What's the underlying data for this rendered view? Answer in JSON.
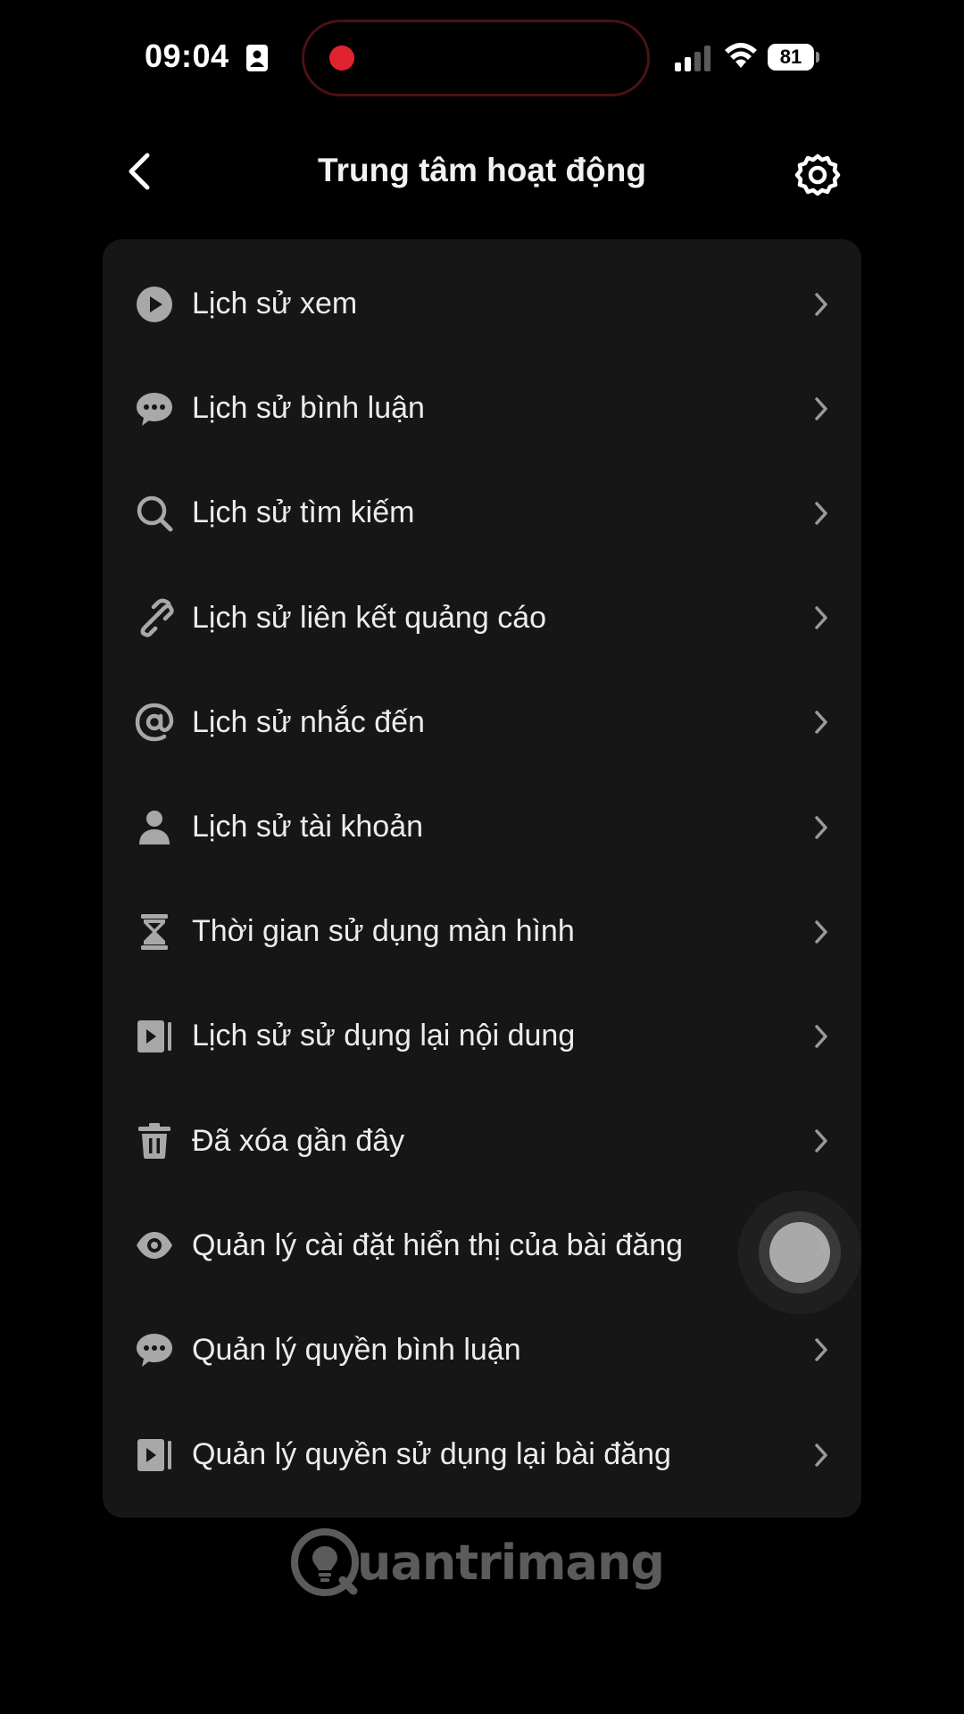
{
  "status_bar": {
    "time": "09:04",
    "battery_level": "81",
    "icons": [
      "person-icon",
      "record-dot",
      "signal-icon",
      "wifi-icon",
      "battery-icon"
    ]
  },
  "header": {
    "title": "Trung tâm hoạt động",
    "back_icon": "chevron-left-icon",
    "settings_icon": "gear-icon"
  },
  "menu": {
    "items": [
      {
        "label": "Lịch sử xem",
        "icon": "play-circle-icon"
      },
      {
        "label": "Lịch sử bình luận",
        "icon": "comment-bubble-icon"
      },
      {
        "label": "Lịch sử tìm kiếm",
        "icon": "search-icon"
      },
      {
        "label": "Lịch sử liên kết quảng cáo",
        "icon": "link-icon"
      },
      {
        "label": "Lịch sử nhắc đến",
        "icon": "at-icon"
      },
      {
        "label": "Lịch sử tài khoản",
        "icon": "person-icon"
      },
      {
        "label": "Thời gian sử dụng màn hình",
        "icon": "hourglass-icon"
      },
      {
        "label": "Lịch sử sử dụng lại nội dung",
        "icon": "video-reuse-icon"
      },
      {
        "label": "Đã xóa gần đây",
        "icon": "trash-icon"
      },
      {
        "label": "Quản lý cài đặt hiển thị của bài đăng",
        "icon": "eye-icon"
      },
      {
        "label": "Quản lý quyền bình luận",
        "icon": "comment-bubble-icon"
      },
      {
        "label": "Quản lý quyền sử dụng lại bài đăng",
        "icon": "video-reuse-icon"
      }
    ]
  },
  "watermark": {
    "text": "uantrimang",
    "icon": "lightbulb-logo-icon"
  },
  "colors": {
    "background": "#000000",
    "card": "#161616",
    "text": "#ececec",
    "icon": "#a8a8a8",
    "record": "#e0242f"
  }
}
